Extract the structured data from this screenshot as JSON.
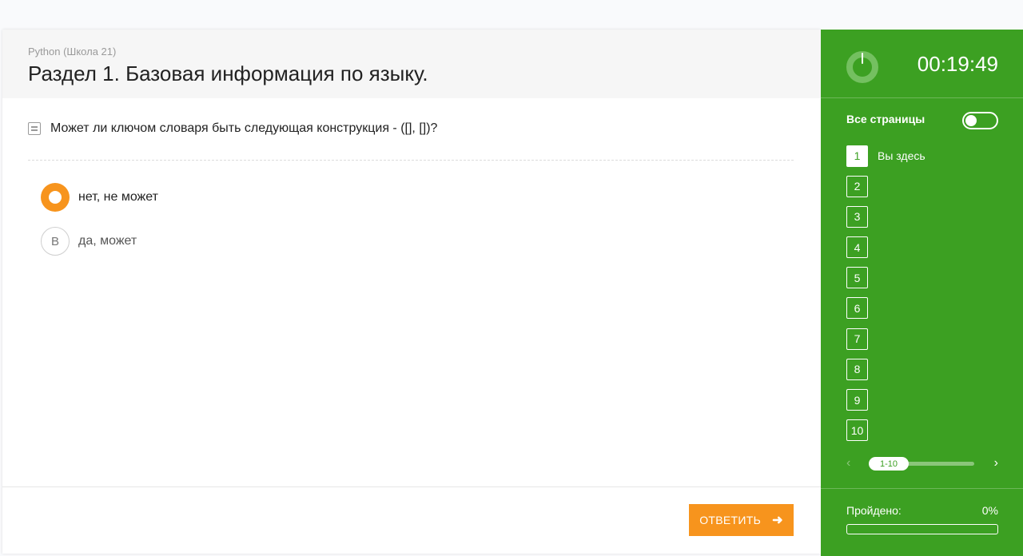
{
  "header": {
    "course": "Python (Школа 21)",
    "title": "Раздел 1. Базовая информация по языку."
  },
  "question": {
    "text": "Может ли ключом словаря быть следующая конструкция - ([], [])?",
    "options": [
      {
        "marker": "",
        "label": "нет, не может",
        "selected": true
      },
      {
        "marker": "B",
        "label": "да, может",
        "selected": false
      }
    ]
  },
  "footer": {
    "answer_label": "ОТВЕТИТЬ",
    "answer_icon": "arrow-right-icon"
  },
  "sidebar": {
    "timer": "00:19:49",
    "clock_icon": "clock-icon",
    "all_pages_label": "Все страницы",
    "all_pages_enabled": false,
    "pages": [
      "1",
      "2",
      "3",
      "4",
      "5",
      "6",
      "7",
      "8",
      "9",
      "10"
    ],
    "current_page": "1",
    "here_label": "Вы здесь",
    "pager_range": "1-10",
    "pager_prev": "‹",
    "pager_next": "›",
    "passed_label": "Пройдено:",
    "passed_value": "0%",
    "passed_fraction": 0
  },
  "colors": {
    "accent": "#f7941d",
    "sidebar": "#3ca022"
  }
}
